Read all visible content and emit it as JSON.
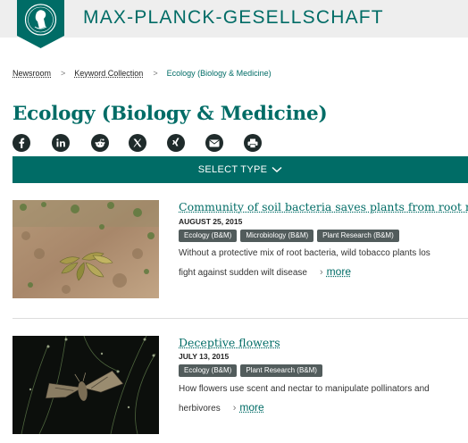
{
  "header": {
    "brand": "MAX-PLANCK-GESELLSCHAFT"
  },
  "breadcrumb": {
    "items": [
      "Newsroom",
      "Keyword Collection",
      "Ecology (Biology & Medicine)"
    ],
    "separator": ">"
  },
  "page": {
    "title": "Ecology (Biology & Medicine)"
  },
  "share": {
    "icons": [
      "facebook-icon",
      "linkedin-icon",
      "reddit-icon",
      "x-icon",
      "xing-icon",
      "email-icon",
      "print-icon"
    ]
  },
  "filter": {
    "label": "SELECT TYPE"
  },
  "articles": [
    {
      "title": "Community of soil bacteria saves plants from root rot",
      "date": "AUGUST 25, 2015",
      "tags": [
        "Ecology (B&M)",
        "Microbiology (B&M)",
        "Plant Research (B&M)"
      ],
      "desc_line1": "Without a protective mix of root bacteria, wild tobacco plants los",
      "desc_line2": "fight against sudden wilt disease",
      "more": "more"
    },
    {
      "title": "Deceptive flowers",
      "date": "JULY 13, 2015",
      "tags": [
        "Ecology (B&M)",
        "Plant Research (B&M)"
      ],
      "desc_line1": "How flowers use scent and nectar to manipulate pollinators and",
      "desc_line2": "herbivores",
      "more": "more"
    }
  ],
  "colors": {
    "brand": "#006c66",
    "tag_bg": "#525c5c",
    "header_bg": "#eeeeee"
  }
}
